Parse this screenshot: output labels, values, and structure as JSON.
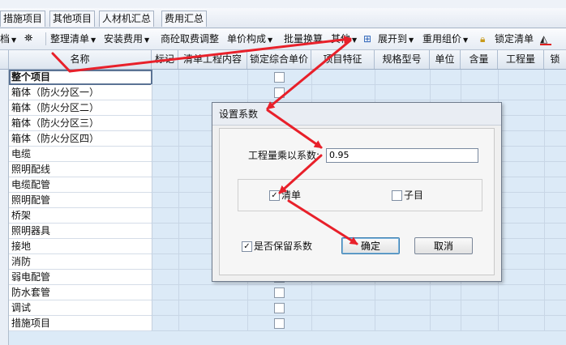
{
  "tabs": [
    "措施项目",
    "其他项目",
    "人材机汇总",
    "费用汇总"
  ],
  "toolbar": {
    "left_fragment": "档",
    "items": [
      "整理清单",
      "安装费用",
      "商砼取费调整",
      "单价构成",
      "批量换算",
      "其他",
      "展开到",
      "重用组价",
      "锁定清单"
    ]
  },
  "grid": {
    "headers": [
      "名称",
      "标记",
      "清单工程内容",
      "锁定综合单价",
      "项目特征",
      "规格型号",
      "单位",
      "含量",
      "工程量",
      "锁"
    ],
    "rows": [
      "整个项目",
      "箱体（防火分区一）",
      "箱体（防火分区二）",
      "箱体（防火分区三）",
      "箱体（防火分区四）",
      "电缆",
      "照明配线",
      "电缆配管",
      "照明配管",
      "桥架",
      "照明器具",
      "接地",
      "消防",
      "弱电配管",
      "防水套管",
      "调试",
      "措施项目"
    ]
  },
  "dialog": {
    "title": "设置系数",
    "factor_label": "工程量乘以系数:",
    "factor_value": "0.95",
    "option_list": "清单",
    "option_list_checked": true,
    "option_sub": "子目",
    "option_sub_checked": false,
    "keep_factor": "是否保留系数",
    "keep_factor_checked": true,
    "ok": "确定",
    "cancel": "取消"
  },
  "colors": {
    "arrow": "#e8202a",
    "grid_bg": "#dceaf7",
    "dialog_bg": "#f0f0f0"
  }
}
